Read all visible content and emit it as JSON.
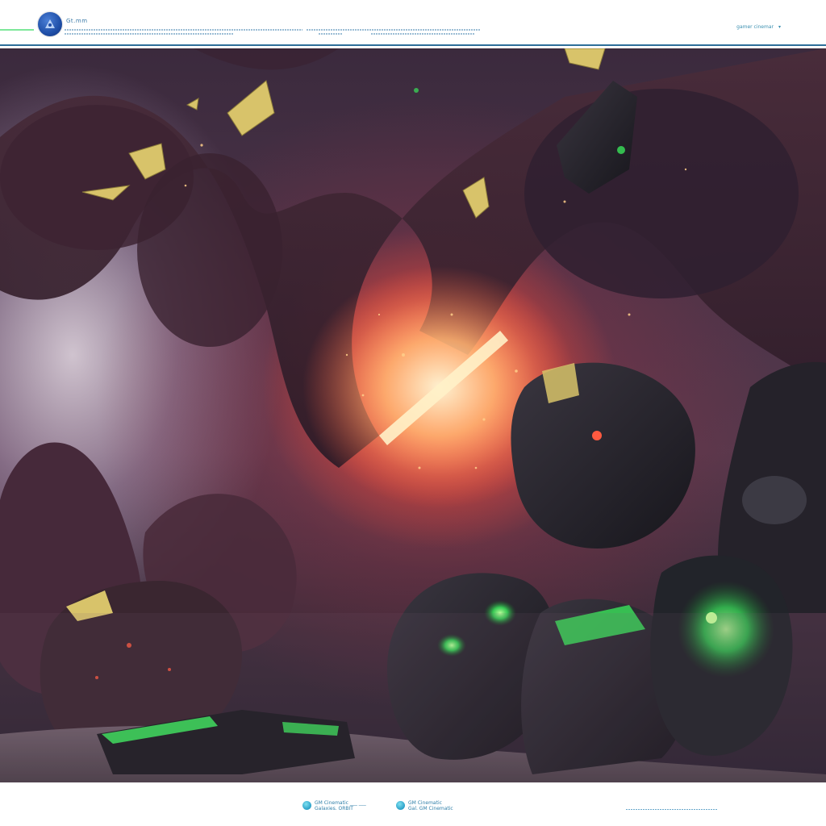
{
  "header": {
    "brand": "Gt.mm",
    "menu_label": "gamer cinemar",
    "menu_chevron": "▾",
    "logo_icon": "rocket-icon"
  },
  "footer": {
    "left_line1": "GM Cinematic ___ ___",
    "left_line2": "Galaxies. ORBIT",
    "right_line1": "GM Cinematic",
    "right_line2": "Gal. GM Cinematic"
  },
  "colors": {
    "header_rule": "#2e6f9a",
    "accent_green": "#39e35a",
    "fire_core": "#ffd7a0",
    "link_blue": "#3a8fb0"
  }
}
